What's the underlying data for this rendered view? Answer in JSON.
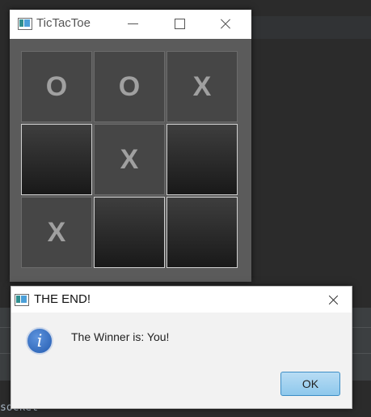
{
  "game_window": {
    "title": "TicTacToe",
    "board": [
      "O",
      "O",
      "X",
      "",
      "X",
      "",
      "X",
      "",
      ""
    ]
  },
  "dialog": {
    "title": "THE END!",
    "message": "The Winner is: You!",
    "ok_label": "OK",
    "icon": "info-icon"
  },
  "background": {
    "console_text": "socket'"
  }
}
